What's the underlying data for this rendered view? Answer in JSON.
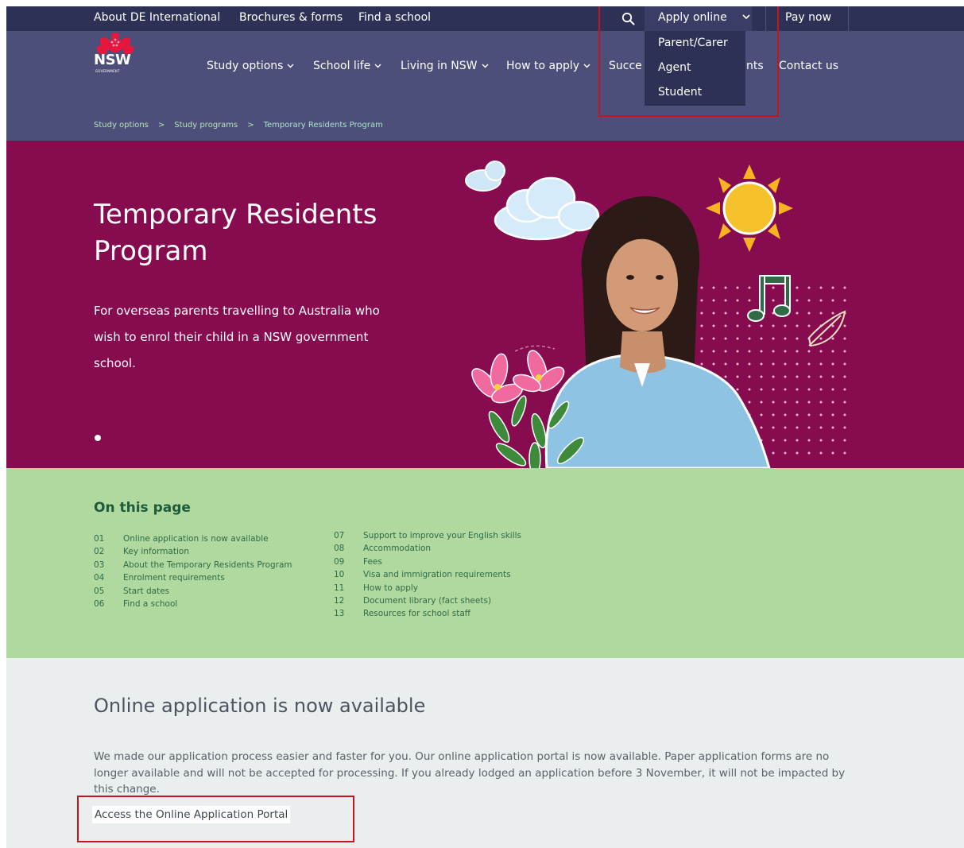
{
  "utility_bar": {
    "links": [
      "About DE International",
      "Brochures & forms",
      "Find a school"
    ],
    "search_icon": "search-icon",
    "apply_online_label": "Apply online",
    "pay_now_label": "Pay now"
  },
  "apply_dropdown": {
    "options": [
      "Parent/Carer",
      "Agent",
      "Student"
    ]
  },
  "logo": {
    "word": "NSW",
    "sub": "GOVERNMENT"
  },
  "main_nav": {
    "study_options": "Study options",
    "school_life": "School life",
    "living_in_nsw": "Living in NSW",
    "how_to_apply": "How to apply",
    "success_stories_visible": "Succe",
    "events_visible": "nts",
    "contact_us": "Contact us"
  },
  "breadcrumb": {
    "items": [
      "Study options",
      "Study programs",
      "Temporary Residents Program"
    ],
    "separator": ">"
  },
  "hero": {
    "title": "Temporary Residents Program",
    "subtitle": "For overseas parents travelling to Australia who wish to enrol their child in a NSW government school."
  },
  "on_this_page": {
    "title": "On this page",
    "column1": [
      {
        "num": "01",
        "label": "Online application is now available"
      },
      {
        "num": "02",
        "label": "Key information"
      },
      {
        "num": "03",
        "label": "About the Temporary Residents Program"
      },
      {
        "num": "04",
        "label": "Enrolment requirements"
      },
      {
        "num": "05",
        "label": "Start dates"
      },
      {
        "num": "06",
        "label": "Find a school"
      }
    ],
    "column2": [
      {
        "num": "07",
        "label": "Support to improve your English skills"
      },
      {
        "num": "08",
        "label": "Accommodation"
      },
      {
        "num": "09",
        "label": "Fees"
      },
      {
        "num": "10",
        "label": "Visa and immigration requirements"
      },
      {
        "num": "11",
        "label": "How to apply"
      },
      {
        "num": "12",
        "label": "Document library (fact sheets)"
      },
      {
        "num": "13",
        "label": "Resources for school staff"
      }
    ]
  },
  "online_application": {
    "title": "Online application is now available",
    "body": "We made our application process easier and faster for you. Our online application portal is now available. Paper application forms are no longer available and will not be accepted for processing. If you already lodged an application before 3 November, it will not be impacted by this change.",
    "link": "Access the Online Application Portal"
  },
  "colors": {
    "utility_bg": "#2e3156",
    "header_bg": "#4c4f79",
    "hero_bg": "#870b4f",
    "on_this_page_bg": "#b0d9a0",
    "content_bg": "#eaeeee",
    "highlight_red": "#c3161c"
  }
}
